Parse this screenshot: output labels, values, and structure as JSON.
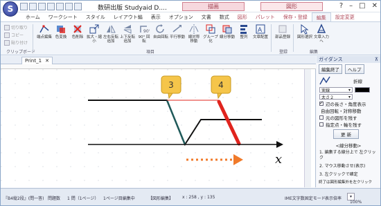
{
  "app": {
    "logo_letter": "S",
    "title": "数研出版 Studyaid D....",
    "context_tab_a": "描画",
    "context_tab_b": "図形"
  },
  "ribbon_tabs": [
    {
      "label": "ホーム"
    },
    {
      "label": "ワークシート"
    },
    {
      "label": "スタイル"
    },
    {
      "label": "レイアウト編"
    },
    {
      "label": "表示"
    },
    {
      "label": "オプション"
    },
    {
      "label": "文書"
    },
    {
      "label": "数式"
    },
    {
      "label": "図形"
    },
    {
      "label": "パレット"
    },
    {
      "label": "保存・登録"
    },
    {
      "label": "編集"
    },
    {
      "label": "設定変更"
    }
  ],
  "clipboard": {
    "cut": "切り取り",
    "copy": "コピー",
    "paste": "貼り付け",
    "group_label": "クリップボード"
  },
  "ribbon_buttons": [
    {
      "label": "端点編集"
    },
    {
      "label": "色変換"
    },
    {
      "label": "色削除"
    },
    {
      "label": "拡大・縮小"
    },
    {
      "label": "左右反転 追加"
    },
    {
      "label": "上下反転 追加"
    },
    {
      "label": "90° 回転"
    },
    {
      "label": "自由回転"
    },
    {
      "label": "平行移動"
    },
    {
      "label": "線対称 移動"
    },
    {
      "label": "グループ化"
    },
    {
      "label": "線分移動"
    },
    {
      "label": "整列"
    },
    {
      "label": "文章配置"
    },
    {
      "label": "部品登録"
    },
    {
      "label": "図形選択"
    },
    {
      "label": "文章入力へ"
    }
  ],
  "ribbon_groups": {
    "item": "項目",
    "register": "登録",
    "edit": "編集"
  },
  "document": {
    "tab_name": "Print_1",
    "callout_1": "3",
    "callout_2": "4",
    "axis_label": "x"
  },
  "panel": {
    "title": "ガイダンス",
    "edit_done": "編集終了",
    "help": "ヘルプ",
    "line_type": "折線",
    "solid": "実線",
    "thickness": "太さ２",
    "show_length": "辺の長さ・角度表示",
    "free_rotation": "自由回転・対称移動",
    "keep_original": "元の図形を残す",
    "fix_point": "指定点・軸を残す",
    "update": "更 新",
    "section": "<線分移動>",
    "step_1": "1. 編集する線分上で 左クリック",
    "step_2": "2. マウス移動させ(表示)",
    "step_3": "3. 左クリックで確定",
    "footer": "終了は図形編集外を左クリック"
  },
  "status": {
    "mode": "『B4縦2段』(問一答)",
    "problem": "問題数",
    "count": "1 問（1ページ）",
    "page": "1ページ目編集中",
    "figure_edit": "【図形編集】",
    "coord": "x : 258 , y : 135",
    "caret_mode": "IME文字数固定モード",
    "display": "表示倍率",
    "zoom": "100%"
  },
  "colors": {
    "highlight_red": "#e0241e",
    "teal_segment": "#1f5a5a",
    "callout_fill": "#f5c54a",
    "arrow_orange": "#f07a2a"
  }
}
